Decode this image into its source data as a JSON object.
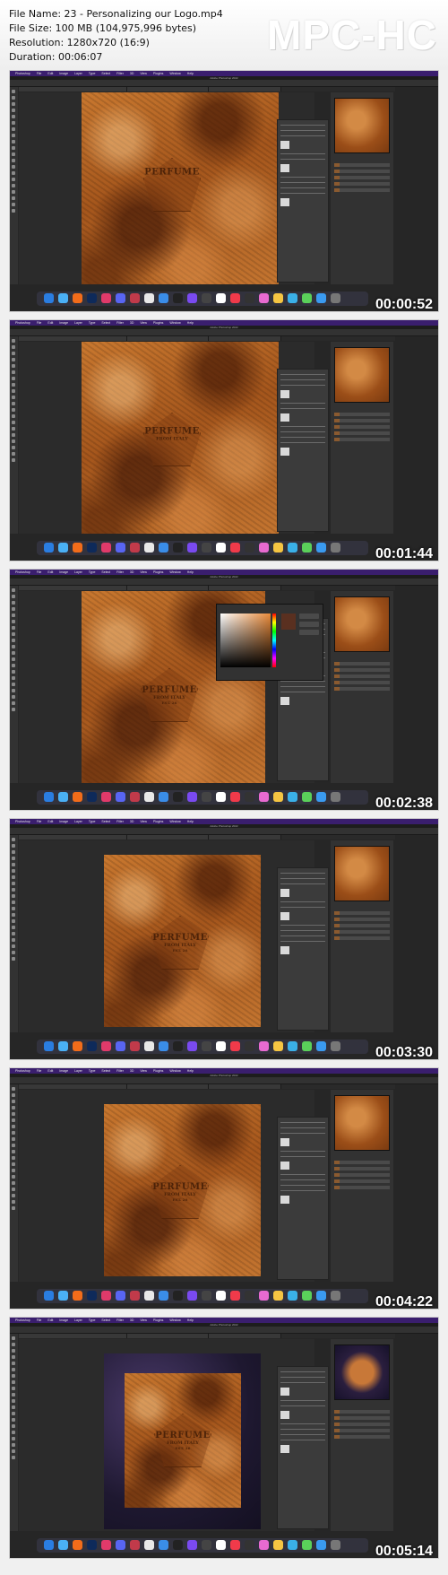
{
  "info": {
    "file_name": "File Name: 23 - Personalizing our Logo.mp4",
    "file_size": "File Size: 100 MB (104,975,996 bytes)",
    "resolution": "Resolution: 1280x720 (16:9)",
    "duration": "Duration: 00:06:07"
  },
  "logo": "MPC-HC",
  "app_menu": [
    "Photoshop",
    "File",
    "Edit",
    "Image",
    "Layer",
    "Type",
    "Select",
    "Filter",
    "3D",
    "View",
    "Plugins",
    "Window",
    "Help"
  ],
  "window_title": "Adobe Photoshop 2022",
  "logo_text": {
    "main": "PERFUME",
    "sub": "FROM ITALY",
    "year": "EST. 26"
  },
  "frames": [
    {
      "timestamp": "00:00:52"
    },
    {
      "timestamp": "00:01:44"
    },
    {
      "timestamp": "00:02:38"
    },
    {
      "timestamp": "00:03:30"
    },
    {
      "timestamp": "00:04:22"
    },
    {
      "timestamp": "00:05:14"
    }
  ],
  "colors": {
    "menubar": "#3a1e6e",
    "texture": "#b5652a",
    "photoshop_bg": "#262626"
  }
}
